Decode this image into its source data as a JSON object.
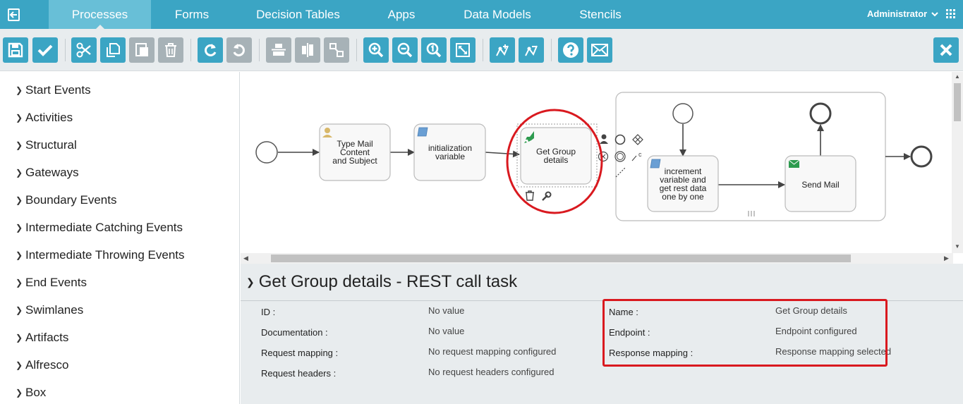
{
  "nav": {
    "tabs": [
      "Processes",
      "Forms",
      "Decision Tables",
      "Apps",
      "Data Models",
      "Stencils"
    ],
    "active_tab": "Processes",
    "user": "Administrator"
  },
  "toolbar": {
    "buttons": [
      "save-icon",
      "validate-icon",
      "cut-icon",
      "copy-icon",
      "paste-icon",
      "delete-icon",
      "redo-icon",
      "undo-icon",
      "align-horizontal-icon",
      "align-vertical-icon",
      "same-size-icon",
      "zoom-in-icon",
      "zoom-out-icon",
      "zoom-actual-icon",
      "zoom-fit-icon",
      "bend-point-add-icon",
      "bend-point-remove-icon",
      "help-icon",
      "feedback-icon",
      "close-icon"
    ]
  },
  "palette": {
    "items": [
      "Start Events",
      "Activities",
      "Structural",
      "Gateways",
      "Boundary Events",
      "Intermediate Catching Events",
      "Intermediate Throwing Events",
      "End Events",
      "Swimlanes",
      "Artifacts",
      "Alfresco",
      "Box"
    ]
  },
  "diagram": {
    "task1": [
      "Type Mail",
      "Content",
      "and Subject"
    ],
    "task2": [
      "initialization",
      "variable"
    ],
    "task3": [
      "Get Group",
      "details"
    ],
    "task4": [
      "increment",
      "variable and",
      "get rest data",
      "one by one"
    ],
    "task5": "Send Mail",
    "shape_menu_c": "c"
  },
  "properties": {
    "title": "Get Group details - REST call task",
    "left": [
      {
        "label": "ID :",
        "value": "No value"
      },
      {
        "label": "Documentation :",
        "value": "No value"
      },
      {
        "label": "Request mapping :",
        "value": "No request mapping configured"
      },
      {
        "label": "Request headers :",
        "value": "No request headers configured"
      }
    ],
    "right": [
      {
        "label": "Name :",
        "value": "Get Group details"
      },
      {
        "label": "Endpoint :",
        "value": "Endpoint configured"
      },
      {
        "label": "Response mapping :",
        "value": "Response mapping selected"
      }
    ]
  },
  "colors": {
    "brand": "#3ba5c4",
    "active_tab": "#68bfd7",
    "highlight": "#d9191f",
    "rest_task_icon": "#2e9b4f"
  }
}
